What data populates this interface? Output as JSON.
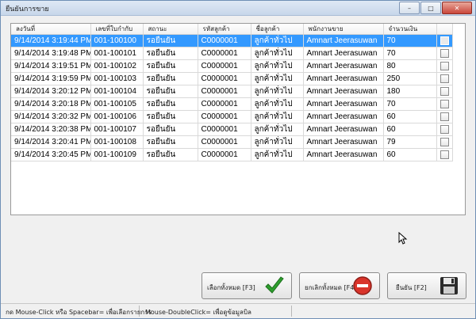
{
  "window": {
    "title": "ยืนยันการขาย"
  },
  "columns": [
    "ลงวันที่",
    "เลขที่ใบกำกับ",
    "สถานะ",
    "รหัสลูกค้า",
    "ชื่อลูกค้า",
    "พนักงานขาย",
    "จำนวนเงิน",
    ""
  ],
  "rows": [
    [
      "9/14/2014 3:19:44 PM",
      "001-100100",
      "รอยืนยัน",
      "C0000001",
      "ลูกค้าทั่วไป",
      "Amnart Jeerasuwan",
      "70"
    ],
    [
      "9/14/2014 3:19:48 PM",
      "001-100101",
      "รอยืนยัน",
      "C0000001",
      "ลูกค้าทั่วไป",
      "Amnart Jeerasuwan",
      "70"
    ],
    [
      "9/14/2014 3:19:51 PM",
      "001-100102",
      "รอยืนยัน",
      "C0000001",
      "ลูกค้าทั่วไป",
      "Amnart Jeerasuwan",
      "80"
    ],
    [
      "9/14/2014 3:19:59 PM",
      "001-100103",
      "รอยืนยัน",
      "C0000001",
      "ลูกค้าทั่วไป",
      "Amnart Jeerasuwan",
      "250"
    ],
    [
      "9/14/2014 3:20:12 PM",
      "001-100104",
      "รอยืนยัน",
      "C0000001",
      "ลูกค้าทั่วไป",
      "Amnart Jeerasuwan",
      "180"
    ],
    [
      "9/14/2014 3:20:18 PM",
      "001-100105",
      "รอยืนยัน",
      "C0000001",
      "ลูกค้าทั่วไป",
      "Amnart Jeerasuwan",
      "70"
    ],
    [
      "9/14/2014 3:20:32 PM",
      "001-100106",
      "รอยืนยัน",
      "C0000001",
      "ลูกค้าทั่วไป",
      "Amnart Jeerasuwan",
      "60"
    ],
    [
      "9/14/2014 3:20:38 PM",
      "001-100107",
      "รอยืนยัน",
      "C0000001",
      "ลูกค้าทั่วไป",
      "Amnart Jeerasuwan",
      "60"
    ],
    [
      "9/14/2014 3:20:41 PM",
      "001-100108",
      "รอยืนยัน",
      "C0000001",
      "ลูกค้าทั่วไป",
      "Amnart Jeerasuwan",
      "79"
    ],
    [
      "9/14/2014 3:20:45 PM",
      "001-100109",
      "รอยืนยัน",
      "C0000001",
      "ลูกค้าทั่วไป",
      "Amnart Jeerasuwan",
      "60"
    ]
  ],
  "selected_row": 0,
  "buttons": {
    "select_all": {
      "label": "เลือกทั้งหมด [F3]",
      "icon": "checkmark-icon"
    },
    "deselect_all": {
      "label": "ยกเลิกทั้งหมด [F4]",
      "icon": "minus-circle-icon"
    },
    "confirm": {
      "label": "ยืนยัน [F2]",
      "icon": "floppy-disk-icon"
    }
  },
  "status": {
    "hint_left": "กด Mouse-Click หรือ Spacebar= เพื่อเลือกรายการ",
    "hint_right": "Mouse-DoubleClick= เพื่อดูข้อมูลบิล"
  },
  "colors": {
    "selection": "#3399ff",
    "check_green": "#2e9e2e",
    "cancel_red": "#d9342b"
  }
}
